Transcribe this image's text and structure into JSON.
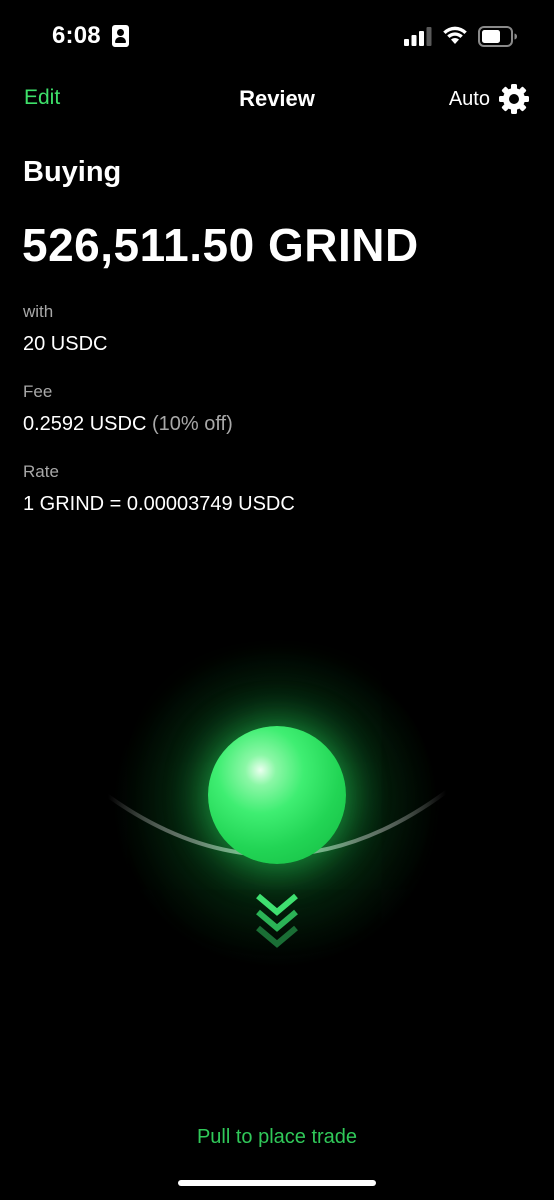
{
  "status_bar": {
    "time": "6:08",
    "icons": [
      "contact-card-icon",
      "cellular-signal-icon",
      "wifi-icon",
      "battery-icon"
    ]
  },
  "header": {
    "edit_label": "Edit",
    "title": "Review",
    "auto_label": "Auto",
    "settings_icon": "gear-icon"
  },
  "trade": {
    "buying_label": "Buying",
    "amount": "526,511.50 GRIND",
    "with_label": "with",
    "with_value": "20 USDC",
    "fee_label": "Fee",
    "fee_value": "0.2592 USDC",
    "fee_discount": "(10% off)",
    "rate_label": "Rate",
    "rate_value": "1 GRIND = 0.00003749 USDC"
  },
  "action": {
    "pull_label": "Pull to place trade",
    "orb_icon": "pull-orb",
    "chevron_icon": "chevron-down-triple-icon"
  },
  "colors": {
    "accent": "#3ee06a",
    "background": "#000000",
    "muted_text": "#a8a8a8",
    "pull_text": "#30c859"
  }
}
